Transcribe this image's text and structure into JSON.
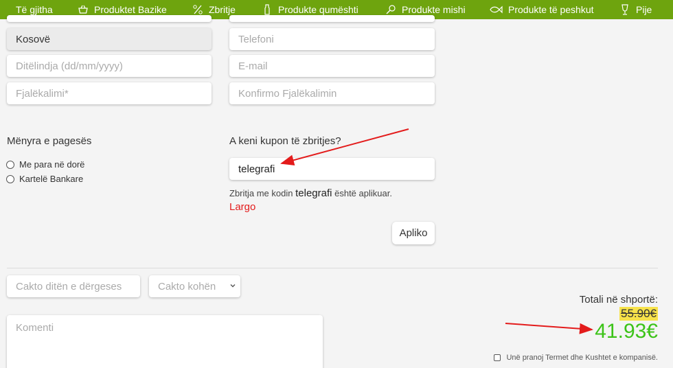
{
  "nav": {
    "items": [
      {
        "label": "Të gjitha",
        "icon": ""
      },
      {
        "label": "Produktet Bazike",
        "icon": "basket-icon"
      },
      {
        "label": "Zbritje",
        "icon": "percent-icon"
      },
      {
        "label": "Produkte qumështi",
        "icon": "milk-bottle-icon"
      },
      {
        "label": "Produkte mishi",
        "icon": "meat-icon"
      },
      {
        "label": "Produkte të peshkut",
        "icon": "fish-icon"
      },
      {
        "label": "Pije",
        "icon": "drink-icon"
      }
    ]
  },
  "form": {
    "country_value": "Kosovë",
    "phone_placeholder": "Telefoni",
    "birthday_placeholder": "Ditëlindja (dd/mm/yyyy)",
    "email_placeholder": "E-mail",
    "password_placeholder": "Fjalëkalimi*",
    "confirm_password_placeholder": "Konfirmo Fjalëkalimin"
  },
  "payment": {
    "title": "Mënyra e pagesës",
    "options": [
      "Me para në dorë",
      "Kartelë Bankare"
    ]
  },
  "coupon": {
    "title": "A keni kupon të zbritjes?",
    "value": "telegrafi",
    "note_prefix": "Zbritja me kodin",
    "note_code": "telegrafi",
    "note_mid": "është aplikuar.",
    "remove_label": "Largo",
    "apply_label": "Apliko"
  },
  "delivery": {
    "date_placeholder": "Cakto ditën e dërgeses",
    "time_placeholder": "Cakto kohën",
    "comment_placeholder": "Komenti"
  },
  "cart": {
    "total_label": "Totali në shportë:",
    "old_price": "55.90€",
    "new_price": "41.93€",
    "terms_label": "Unë pranoj Termet dhe Kushtet e kompanisë."
  },
  "colors": {
    "nav_bg": "#6ea40e",
    "new_price": "#3cc318",
    "remove_link": "#e31b1b",
    "highlight": "#f7e24a",
    "annotation_arrow": "#e31b1b"
  }
}
